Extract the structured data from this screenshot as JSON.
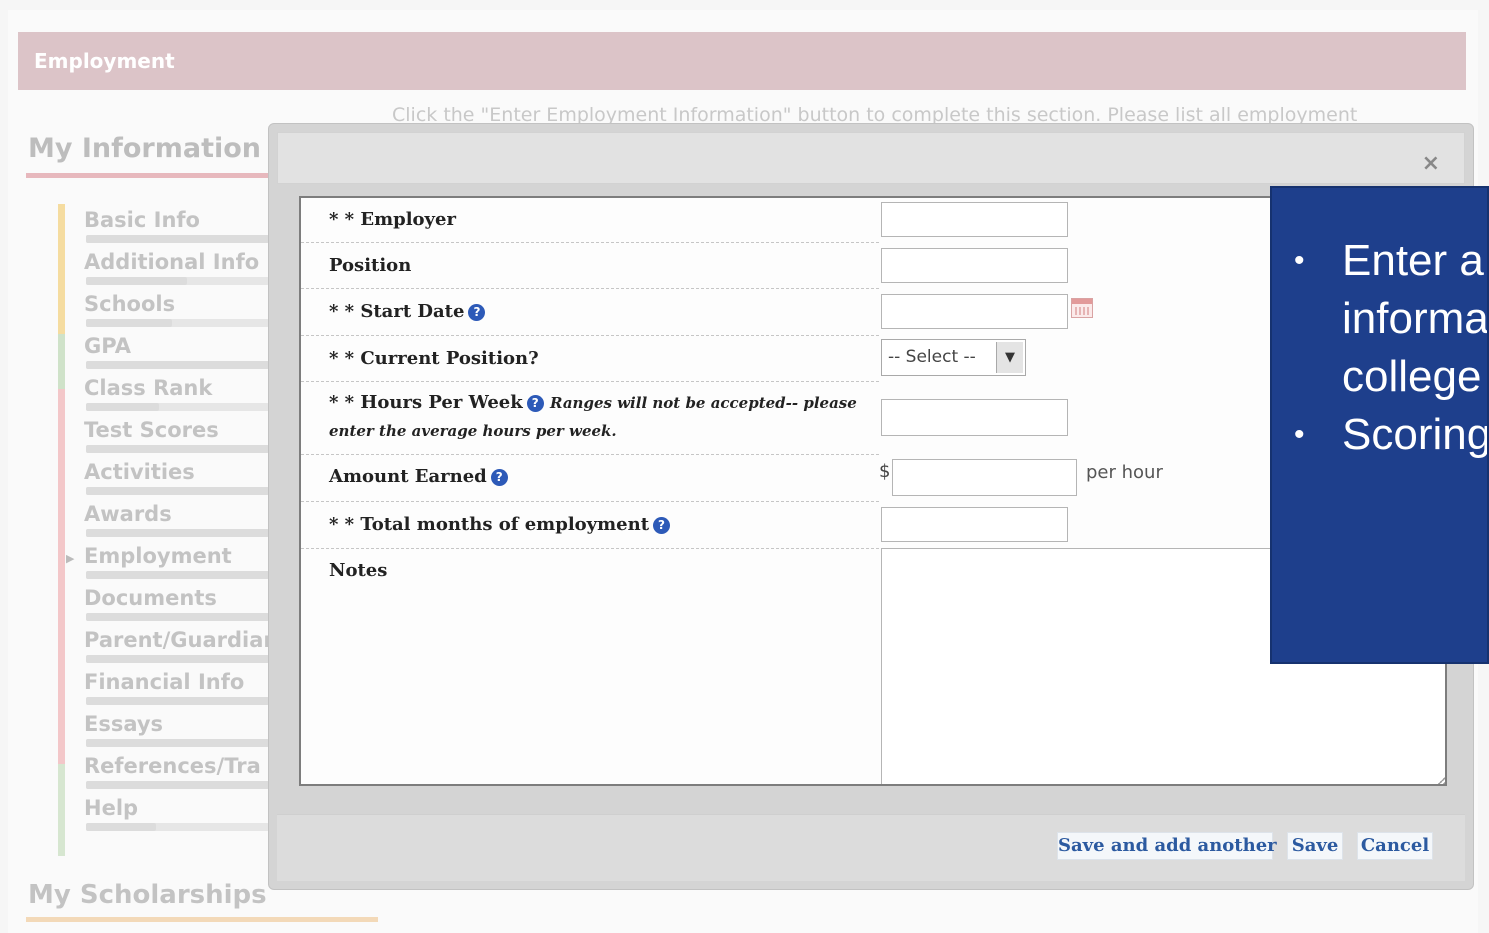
{
  "section": {
    "title": "Employment",
    "instruction": "Click the \"Enter Employment Information\" button to complete this section. Please list all employment"
  },
  "sidebar": {
    "title": "My Information",
    "items": [
      {
        "label": "Basic Info",
        "progress": 1.0
      },
      {
        "label": "Additional Info",
        "progress": 0.55
      },
      {
        "label": "Schools",
        "progress": 0.47
      },
      {
        "label": "GPA",
        "progress": 1.0
      },
      {
        "label": "Class Rank",
        "progress": 0.4
      },
      {
        "label": "Test Scores",
        "progress": 1.0
      },
      {
        "label": "Activities",
        "progress": 1.0
      },
      {
        "label": "Awards",
        "progress": 1.0
      },
      {
        "label": "Employment",
        "progress": 1.0,
        "active": true
      },
      {
        "label": "Documents",
        "progress": 1.0
      },
      {
        "label": "Parent/Guardian",
        "progress": 1.0
      },
      {
        "label": "Financial Info",
        "progress": 1.0
      },
      {
        "label": "Essays",
        "progress": 1.0
      },
      {
        "label": "References/Tra",
        "progress": 1.0
      },
      {
        "label": "Help",
        "progress": 0.38
      }
    ],
    "scholarships_title": "My Scholarships"
  },
  "modal": {
    "close_icon": "×",
    "help_glyph": "?",
    "fields": {
      "employer": {
        "label": "* * Employer",
        "value": ""
      },
      "position": {
        "label": "Position",
        "value": ""
      },
      "start_date": {
        "label": "* * Start Date",
        "value": ""
      },
      "current_position": {
        "label": "* * Current Position?",
        "selected": "-- Select --"
      },
      "hours_per_week": {
        "label": "* * Hours Per Week",
        "note_1": "Ranges will not be accepted-- please",
        "note_2": "enter the average hours per week.",
        "value": ""
      },
      "amount_earned": {
        "label": "Amount Earned",
        "currency": "$",
        "unit": "per hour",
        "value": ""
      },
      "total_months": {
        "label": "* * Total months of employment",
        "value": ""
      },
      "notes": {
        "label": "Notes",
        "value": ""
      }
    },
    "buttons": {
      "save_add": "Save and add another",
      "save": "Save",
      "cancel": "Cancel"
    }
  },
  "callout": {
    "bullets": [
      "Enter a employ informa high sc college",
      "Scoring comple"
    ]
  },
  "colors": {
    "header_bg": "#dcc4c8",
    "callout_bg": "#1e3f8c",
    "button_text": "#2c5aa0",
    "help_icon": "#2d5ab8"
  }
}
